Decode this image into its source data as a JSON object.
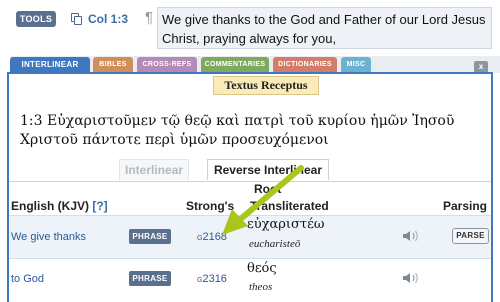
{
  "toolbar": {
    "tools_label": "TOOLS",
    "verse_ref": "Col 1:3",
    "pilcrow": "¶",
    "verse_text": "We give thanks to the God and Father of our Lord Jesus Christ, praying always for you,"
  },
  "tabs": {
    "interlinear": "INTERLINEAR",
    "bibles": "BIBLES",
    "crossrefs": "CROSS-REFS",
    "commentaries": "COMMENTARIES",
    "dictionaries": "DICTIONARIES",
    "misc": "MISC",
    "close": "x"
  },
  "panel": {
    "source_label": "Textus Receptus",
    "greek_verse": "1:3  Εὐχαριστοῦμεν τῷ θεῷ καὶ πατρὶ τοῦ κυρίου ἡμῶν Ἰησοῦ Χριστοῦ πάντοτε περὶ ὑμῶν προσευχόμενοι",
    "sub_tabs": {
      "interlinear": "Interlinear",
      "reverse": "Reverse Interlinear"
    }
  },
  "table": {
    "headers": {
      "english": "English (KJV)",
      "english_help": "[?]",
      "strongs": "Strong's",
      "root": "Root",
      "transliterated": "Transliterated",
      "parsing": "Parsing"
    },
    "rows": [
      {
        "english": "We give thanks",
        "phrase": "PHRASE",
        "strongs_prefix": "G",
        "strongs": "2168",
        "greek": "εὐχαριστέω",
        "translit": "eucharisteō",
        "parse": "PARSE"
      },
      {
        "english": "to God",
        "phrase": "PHRASE",
        "strongs_prefix": "G",
        "strongs": "2316",
        "greek": "θεός",
        "translit": "theos"
      }
    ]
  },
  "colors": {
    "accent_blue": "#3f78bf",
    "arrow": "#a8c61c",
    "button_slate": "#5b708e"
  },
  "icons": [
    "copy-icon",
    "speaker-icon",
    "close-icon",
    "arrow-annotation"
  ]
}
